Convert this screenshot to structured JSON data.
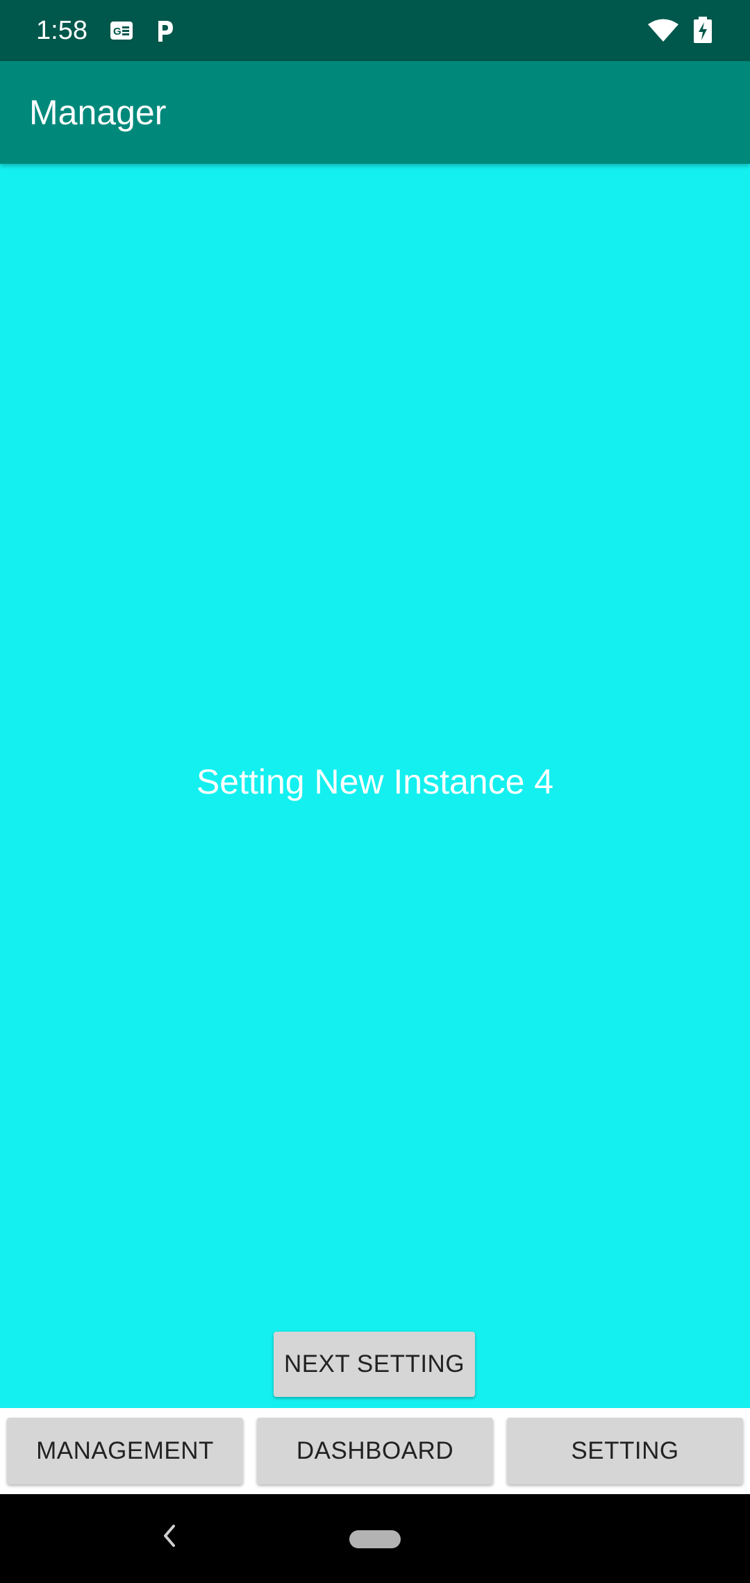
{
  "status_bar": {
    "time": "1:58",
    "icons": [
      "news-icon",
      "parking-icon",
      "wifi-icon",
      "battery-charging-icon"
    ]
  },
  "app_bar": {
    "title": "Manager"
  },
  "content": {
    "center_text": "Setting New Instance 4",
    "next_button": "NEXT SETTING",
    "background_color": "#14f0ef"
  },
  "bottom_nav": {
    "items": [
      "MANAGEMENT",
      "DASHBOARD",
      "SETTING"
    ]
  },
  "system_nav": {
    "icons": [
      "back-icon",
      "home-pill"
    ]
  },
  "colors": {
    "status_bar": "#00574b",
    "app_bar": "#00897b",
    "button": "#d6d6d6"
  }
}
